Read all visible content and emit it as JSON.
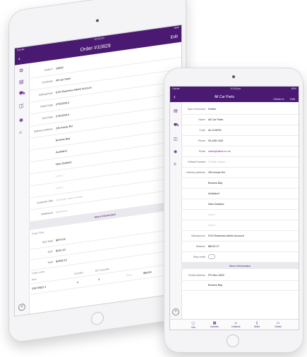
{
  "back_device": {
    "status": {
      "left": "Carrier",
      "center": "10:18 pm",
      "right": "80%"
    },
    "nav": {
      "back": "‹",
      "title": "Order #10829",
      "edit": "Edit"
    },
    "sidebar_icons": [
      "settings-icon",
      "document-icon",
      "truck-icon",
      "gift-icon",
      "user-icon",
      "location-icon"
    ],
    "fields": [
      {
        "label": "Order #",
        "value": "10829",
        "placeholder": false
      },
      {
        "label": "Customer",
        "value": "All Car Parts",
        "placeholder": false
      },
      {
        "label": "Salesperson",
        "value": "EXO Business Admin Account",
        "placeholder": false
      },
      {
        "label": "Order Date",
        "value": "07/03/2014",
        "placeholder": false
      },
      {
        "label": "Due Date",
        "value": "07/03/2014",
        "placeholder": false
      },
      {
        "label": "Delivery Address",
        "value": "230 Anzac Rd",
        "placeholder": false
      },
      {
        "label": "",
        "value": "Browns Bay",
        "placeholder": false
      },
      {
        "label": "",
        "value": "Auckland",
        "placeholder": false
      },
      {
        "label": "",
        "value": "New Zealand",
        "placeholder": false
      },
      {
        "label": "",
        "value": "Line 5",
        "placeholder": true
      },
      {
        "label": "",
        "value": "Line 6",
        "placeholder": true
      },
      {
        "label": "Customer O/N",
        "value": "Customer order number",
        "placeholder": true
      },
      {
        "label": "Reference",
        "value": "Reference",
        "placeholder": true
      }
    ],
    "more_info": "More Information",
    "order_total_heading": "Order Total",
    "totals": [
      {
        "label": "Sub-Total",
        "value": "$874.02"
      },
      {
        "label": "GST",
        "value": "$131.10"
      },
      {
        "label": "Total",
        "value": "$1005.12"
      }
    ],
    "order_lines_heading": "Order Lines",
    "lines_header": {
      "item": "Item",
      "quantity": "Quantity",
      "bo_quantity": "B/O Quantity"
    },
    "line": {
      "item": "SSP-RED-1",
      "quantity": "4",
      "bo_quantity": "4",
      "price_label": "Price",
      "price": "$58.00"
    }
  },
  "front_device": {
    "status": {
      "left": "Carrier",
      "center": "10:18 pm",
      "right": "80%"
    },
    "nav": {
      "back": "‹",
      "title": "All Car Parts",
      "check_in": "Check in",
      "edit": "Edit"
    },
    "sidebar_icons": [
      "document-icon",
      "truck-icon",
      "gift-icon",
      "user-icon",
      "location-icon"
    ],
    "fields": [
      {
        "label": "Type of Account",
        "value": "Debtor",
        "placeholder": false,
        "link": false
      },
      {
        "label": "Name",
        "value": "All Car Parts",
        "placeholder": false,
        "link": false
      },
      {
        "label": "Code",
        "value": "ALLCAR01",
        "placeholder": false,
        "link": false
      },
      {
        "label": "Phone",
        "value": "09-455 1432",
        "placeholder": false,
        "link": false
      },
      {
        "label": "Email",
        "value": "sales@allcar.co.nz",
        "placeholder": false,
        "link": true
      },
      {
        "label": "Default Contact",
        "value": "Default contact",
        "placeholder": true,
        "link": false
      },
      {
        "label": "Delivery Address",
        "value": "230 Anzac Rd",
        "placeholder": false,
        "link": false
      },
      {
        "label": "",
        "value": "Browns Bay",
        "placeholder": false,
        "link": false
      },
      {
        "label": "",
        "value": "Auckland",
        "placeholder": false,
        "link": false
      },
      {
        "label": "",
        "value": "New Zealand",
        "placeholder": false,
        "link": false
      },
      {
        "label": "",
        "value": "Line 5",
        "placeholder": true,
        "link": false
      },
      {
        "label": "",
        "value": "Line 6",
        "placeholder": true,
        "link": false
      },
      {
        "label": "Salesperson",
        "value": "EXO Business Admin Account",
        "placeholder": false,
        "link": false
      },
      {
        "label": "Balance",
        "value": "$8113.27",
        "placeholder": false,
        "link": false
      },
      {
        "label": "Stop credit",
        "value": "",
        "placeholder": false,
        "link": false
      }
    ],
    "more_info": "More Information",
    "postal": [
      {
        "label": "Postal Address",
        "value": "PO Box 3459"
      },
      {
        "label": "",
        "value": "Browns Bay"
      }
    ],
    "tabs": [
      {
        "label": "Info",
        "icon": "info-icon"
      },
      {
        "label": "Invoices",
        "icon": "invoice-icon"
      },
      {
        "label": "Contacts",
        "icon": "contacts-icon"
      },
      {
        "label": "Notes",
        "icon": "notes-icon"
      },
      {
        "label": "Orders",
        "icon": "orders-icon"
      }
    ]
  }
}
